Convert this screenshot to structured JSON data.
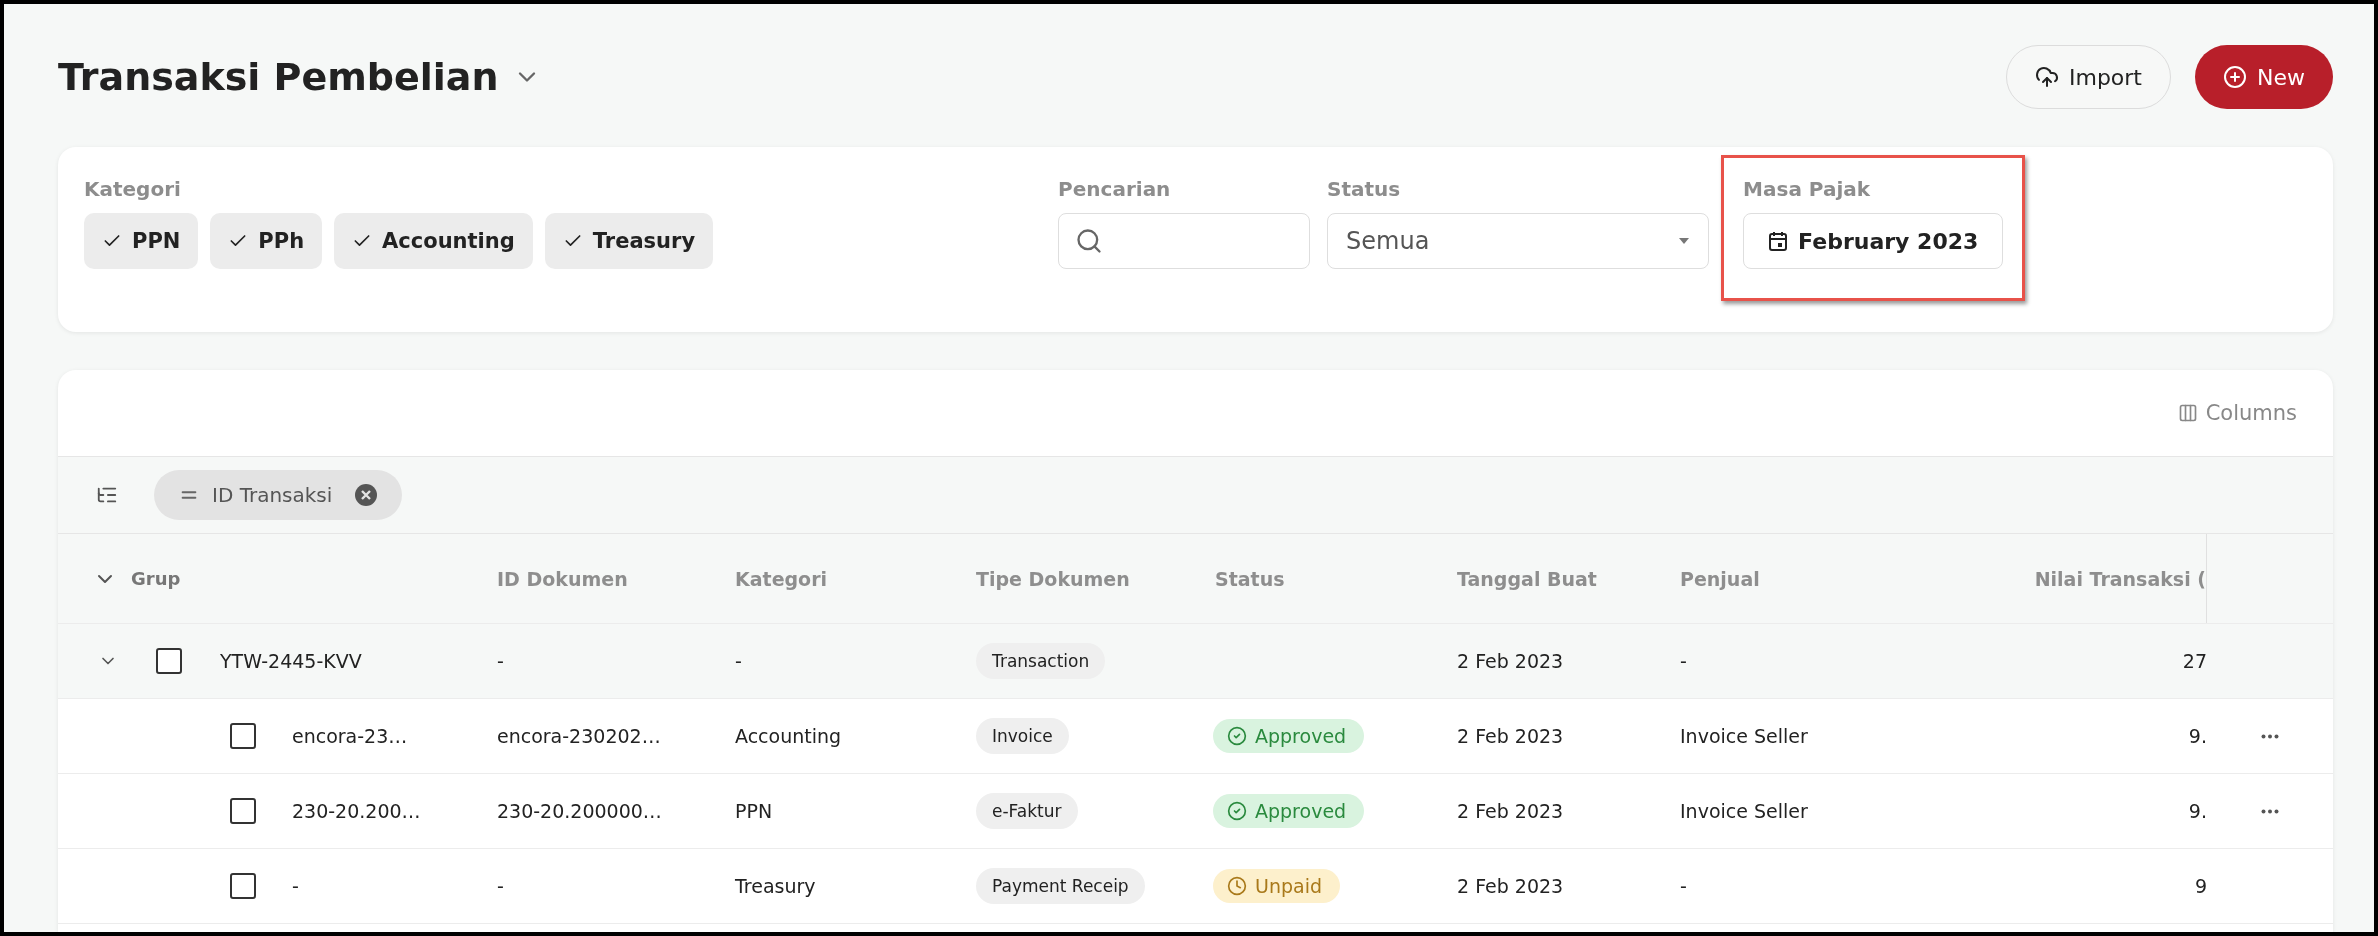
{
  "page": {
    "title": "Transaksi Pembelian"
  },
  "actions": [
    {
      "kind": "outline",
      "label": "Import"
    },
    {
      "kind": "primary",
      "label": "New"
    }
  ],
  "filters": {
    "kategori": {
      "label": "Kategori",
      "chips": [
        {
          "label": "PPN",
          "checked": true
        },
        {
          "label": "PPh",
          "checked": true
        },
        {
          "label": "Accounting",
          "checked": true
        },
        {
          "label": "Treasury",
          "checked": true
        }
      ]
    },
    "search": {
      "label": "Pencarian"
    },
    "status": {
      "label": "Status",
      "value": "Semua"
    },
    "masa_pajak": {
      "label": "Masa Pajak",
      "value": "February 2023",
      "highlighted": true
    }
  },
  "table": {
    "columns_button": "Columns",
    "group_by": [
      {
        "label": "ID Transaksi"
      }
    ],
    "columns": [
      "Grup",
      "ID Dokumen",
      "Kategori",
      "Tipe Dokumen",
      "Status",
      "Tanggal Buat",
      "Penjual",
      "Nilai Transaksi ("
    ],
    "groups": [
      {
        "name": "YTW-2445-KVV",
        "expanded": true,
        "checked": false,
        "id_dokumen": "-",
        "kategori": "-",
        "tipe": "Transaction",
        "tanggal": "2 Feb 2023",
        "penjual": "-",
        "nilai": "27",
        "children": [
          {
            "name": "encora-23…",
            "checked": false,
            "id_dokumen": "encora-230202…",
            "kategori": "Accounting",
            "tipe": "Invoice",
            "status": {
              "kind": "approved",
              "label": "Approved"
            },
            "tanggal": "2 Feb 2023",
            "penjual": "Invoice Seller",
            "nilai": "9.",
            "more": true
          },
          {
            "name": "230-20.200…",
            "checked": false,
            "id_dokumen": "230-20.200000…",
            "kategori": "PPN",
            "tipe": "e-Faktur",
            "status": {
              "kind": "approved",
              "label": "Approved"
            },
            "tanggal": "2 Feb 2023",
            "penjual": "Invoice Seller",
            "nilai": "9.",
            "more": true
          },
          {
            "name": "-",
            "checked": false,
            "id_dokumen": "-",
            "kategori": "Treasury",
            "tipe": "Payment Receip",
            "status": {
              "kind": "unpaid",
              "label": "Unpaid"
            },
            "tanggal": "2 Feb 2023",
            "penjual": "-",
            "nilai": "9",
            "more": false
          }
        ]
      }
    ]
  }
}
